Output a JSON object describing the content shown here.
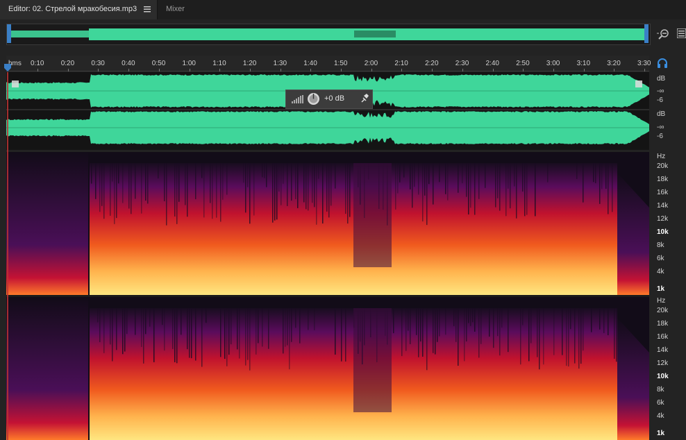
{
  "tabs": {
    "editor_label": "Editor: 02. Стрелой мракобесия.mp3",
    "mixer_label": "Mixer",
    "menu_icon": "hamburger-icon"
  },
  "toolbar": {
    "zoom_icon": "zoom-out-icon",
    "panel_menu_icon": "panel-menu-icon",
    "headphone_icon": "headphone-icon"
  },
  "ruler": {
    "unit_label": "hms",
    "ticks": [
      "0:10",
      "0:20",
      "0:30",
      "0:40",
      "0:50",
      "1:00",
      "1:10",
      "1:20",
      "1:30",
      "1:40",
      "1:50",
      "2:00",
      "2:10",
      "2:20",
      "2:30",
      "2:40",
      "2:50",
      "3:00",
      "3:10",
      "3:20",
      "3:30"
    ]
  },
  "waveform": {
    "color": "#3fd69a",
    "channels": [
      {
        "db_unit": "dB",
        "db_inf": "-∞",
        "db_low": "-6"
      },
      {
        "db_unit": "dB",
        "db_inf": "-∞",
        "db_low": "-6"
      }
    ]
  },
  "hud": {
    "gain_value": "+0 dB",
    "pin_icon": "pin-icon",
    "level_icon": "level-bars-icon",
    "knob_icon": "volume-knob-icon"
  },
  "spectral": {
    "unit": "Hz",
    "labels": [
      "20k",
      "18k",
      "16k",
      "14k",
      "12k",
      "10k",
      "8k",
      "6k",
      "4k",
      "1k"
    ],
    "bold_labels": [
      "10k",
      "1k"
    ]
  },
  "colors": {
    "accent": "#3a7fc6",
    "waveform": "#3fd69a",
    "playhead": "#b33333"
  }
}
